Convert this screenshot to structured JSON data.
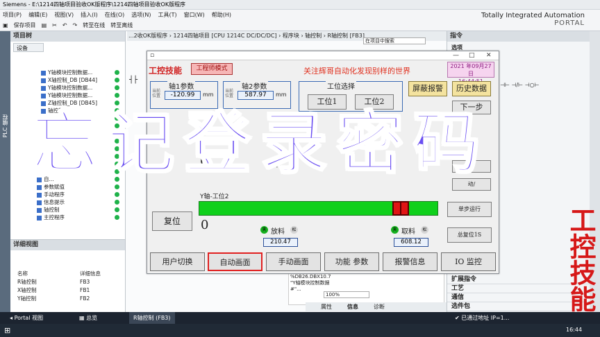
{
  "window": {
    "title": "Siemens  -  E:\\1214四轴项目验收OK版程序\\1214四轴项目验收OK版程序",
    "brand_line1": "Totally Integrated Automation",
    "brand_line2": "PORTAL"
  },
  "menu": [
    "项目(P)",
    "编辑(E)",
    "视图(V)",
    "插入(I)",
    "在线(O)",
    "选项(N)",
    "工具(T)",
    "窗口(W)",
    "帮助(H)"
  ],
  "toolbar": {
    "save_label": "保存项目",
    "online_label": "转至在线",
    "offline_label": "转至离线"
  },
  "left_strip_label": "PLC 编程",
  "project_tree": {
    "header": "项目树",
    "tab": "设备",
    "items": [
      "Y轴模块控制数据...",
      "X轴控制_DB [DB44]",
      "Y轴模块控制数据...",
      "Y轴模块控制数据...",
      "Z轴控制_DB [DB45]",
      "轴控制",
      "",
      "",
      "",
      "",
      "",
      "",
      "",
      "",
      "自...",
      "参数赋值",
      "手动程序",
      "信息提示",
      "轴控制",
      "主控程序"
    ]
  },
  "detail_view": {
    "header": "详细视图",
    "col_name": "名称",
    "col_info": "详细信息",
    "rows": [
      {
        "name": "R轴控制",
        "info": "FB3"
      },
      {
        "name": "X轴控制",
        "info": "FB1"
      },
      {
        "name": "Y轴控制",
        "info": "FB2"
      }
    ]
  },
  "breadcrumb": "...2收OK版程序 › 1214四轴项目 [CPU 1214C DC/DC/DC] › 程序块 › 轴控制 › R轴控制 [FB3]",
  "right_panel": {
    "header": "指令",
    "options": "选项",
    "sections": [
      "扩展指令",
      "工艺",
      "通信",
      "选件包"
    ]
  },
  "code_snippet": {
    "line1": "%DB26.DBX10.7",
    "line2": "\"Y轴模块控制数据",
    "line3": "#\"...",
    "zoom": "100%",
    "online_mode": "在项目中搜索"
  },
  "bottom_tabs": {
    "properties": "属性",
    "info": "信息",
    "diagnostics": "诊断"
  },
  "taskbar": {
    "portal": "Portal 视图",
    "overview": "总览",
    "fb3": "R轴控制 (FB3)",
    "status": "已通过地址 IP=1...",
    "time": "16:44"
  },
  "hmi": {
    "logo": "工控技能",
    "mode_button": "工程师模式",
    "slogan": "关注辉哥自动化发现别样的世界",
    "date": "2021 年09月27日",
    "time": "16:44:51",
    "axis1": {
      "title": "轴1参数",
      "lbl_cur": "当前位置",
      "value": "-120.99",
      "unit": "mm"
    },
    "axis2": {
      "title": "轴2参数",
      "lbl_cur": "当前位置",
      "value": "587.97",
      "unit": "mm"
    },
    "pos_select": {
      "title": "工位选择",
      "btn1": "工位1",
      "btn2": "工位2"
    },
    "btn_mask_alarm": "屏蔽报警",
    "btn_history": "历史数据",
    "btn_next": "下一步",
    "btn_step_run": "单步运行",
    "btn_total_reset": "总复位1S",
    "btn_reset": "复位",
    "btn_auto_partial": "动/",
    "btn_step_partial": "步",
    "y_axis_label": "Y轴-工位2",
    "y_axis_zero": "0",
    "small_zero": "0",
    "place": {
      "label": "放料",
      "value": "210.47",
      "led_left": "夹",
      "led_right": "松"
    },
    "take": {
      "label": "取料",
      "value": "608.12",
      "led_left": "夹",
      "led_right": "松"
    },
    "upper_material": "料",
    "y_slider_fraction": 0.87,
    "tabs": [
      "用户切换",
      "自动画面",
      "手动画面",
      "功能 参数",
      "报警信息",
      "IO 监控"
    ]
  },
  "overlay": {
    "big_text": "忘记登录密码",
    "vertical_text": "工控技能"
  }
}
